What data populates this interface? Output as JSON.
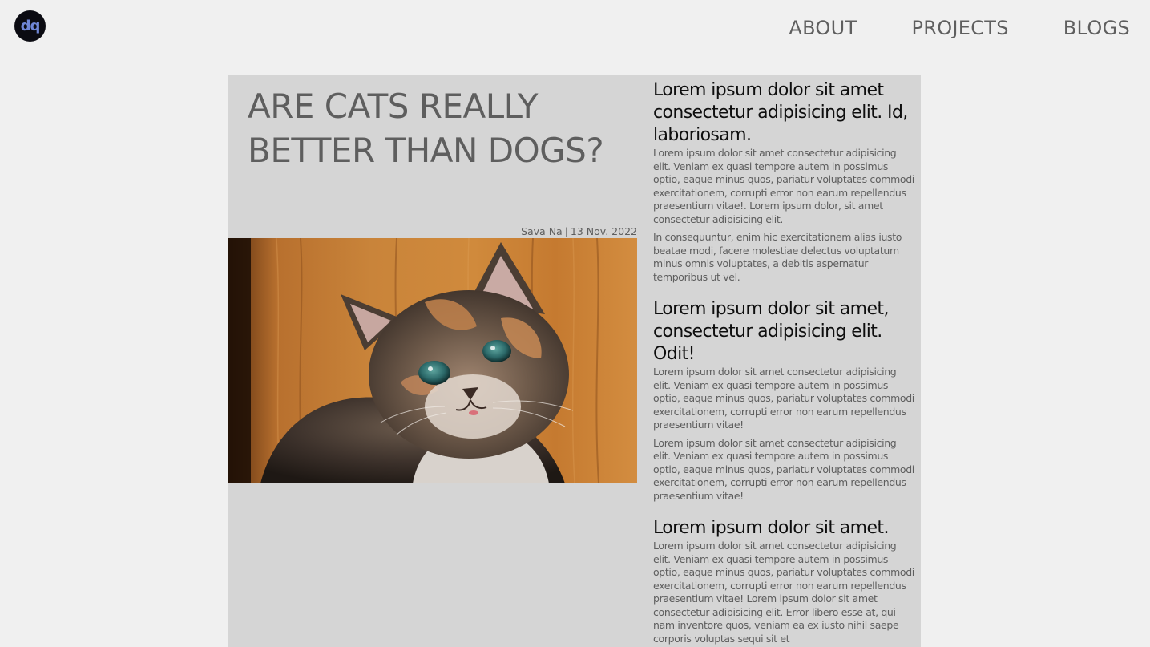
{
  "header": {
    "logo_text": "dq",
    "nav": [
      {
        "label": "ABOUT"
      },
      {
        "label": "PROJECTS"
      },
      {
        "label": "BLOGS"
      }
    ]
  },
  "article": {
    "title": "ARE CATS REALLY BETTER THAN DOGS?",
    "author": "Sava Na",
    "date": "13 Nov. 2022",
    "image_alt": "kitten photo"
  },
  "sections": [
    {
      "heading": "Lorem ipsum dolor sit amet consectetur adipisicing elit. Id, laboriosam.",
      "paragraphs": [
        "Lorem ipsum dolor sit amet consectetur adipisicing elit. Veniam ex quasi tempore autem in possimus optio, eaque minus quos, pariatur voluptates commodi exercitationem, corrupti error non earum repellendus praesentium vitae!. Lorem ipsum dolor, sit amet consectetur adipisicing elit.",
        "In consequuntur, enim hic exercitationem alias iusto beatae modi, facere molestiae delectus voluptatum minus omnis voluptates, a debitis aspernatur temporibus ut vel."
      ]
    },
    {
      "heading": "Lorem ipsum dolor sit amet, consectetur adipisicing elit. Odit!",
      "paragraphs": [
        "Lorem ipsum dolor sit amet consectetur adipisicing elit. Veniam ex quasi tempore autem in possimus optio, eaque minus quos, pariatur voluptates commodi exercitationem, corrupti error non earum repellendus praesentium vitae!",
        "Lorem ipsum dolor sit amet consectetur adipisicing elit. Veniam ex quasi tempore autem in possimus optio, eaque minus quos, pariatur voluptates commodi exercitationem, corrupti error non earum repellendus praesentium vitae!"
      ]
    },
    {
      "heading": "Lorem ipsum dolor sit amet.",
      "paragraphs": [
        "Lorem ipsum dolor sit amet consectetur adipisicing elit. Veniam ex quasi tempore autem in possimus optio, eaque minus quos, pariatur voluptates commodi exercitationem, corrupti error non earum repellendus praesentium vitae! Lorem ipsum dolor sit amet consectetur adipisicing elit. Error libero esse at, qui nam inventore quos, veniam ea ex iusto nihil saepe corporis voluptas sequi sit et"
      ]
    }
  ]
}
